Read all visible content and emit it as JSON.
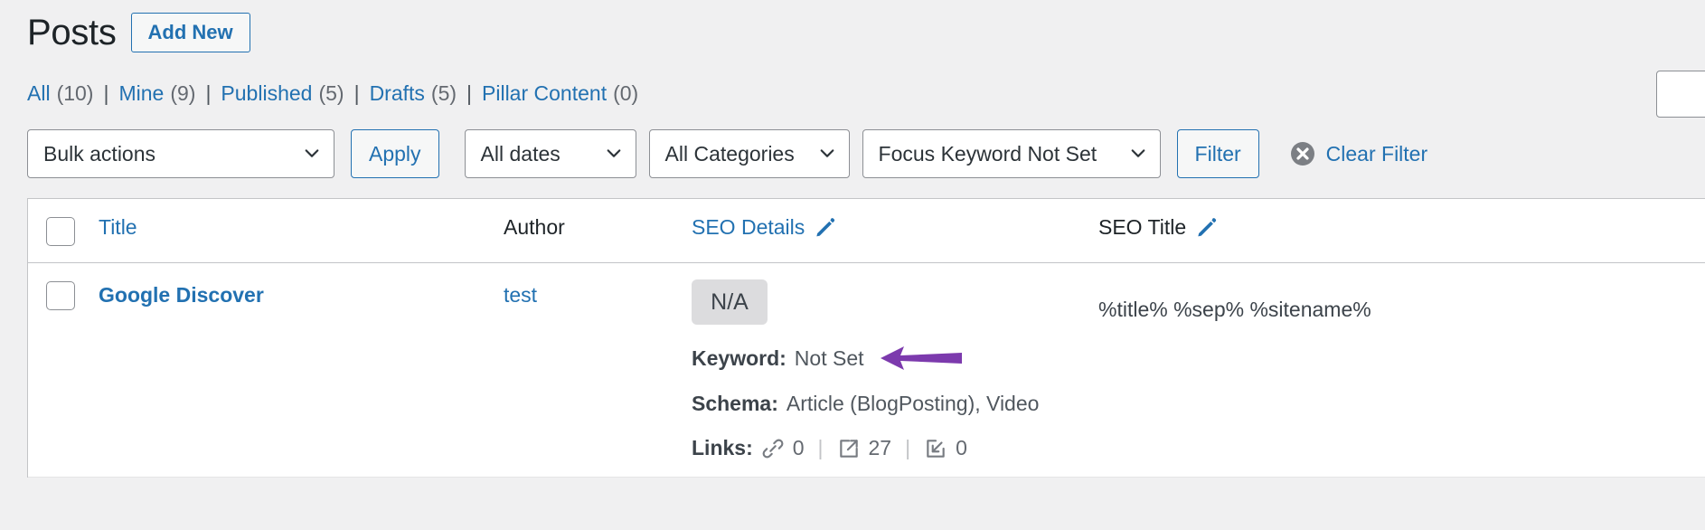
{
  "header": {
    "title": "Posts",
    "add_new_label": "Add New"
  },
  "status_links": [
    {
      "label": "All",
      "count": "(10)"
    },
    {
      "label": "Mine",
      "count": "(9)"
    },
    {
      "label": "Published",
      "count": "(5)"
    },
    {
      "label": "Drafts",
      "count": "(5)"
    },
    {
      "label": "Pillar Content",
      "count": "(0)"
    }
  ],
  "separator": "|",
  "toolbar": {
    "bulk_actions": "Bulk actions",
    "apply_label": "Apply",
    "all_dates": "All dates",
    "all_categories": "All Categories",
    "focus_keyword": "Focus Keyword Not Set",
    "filter_label": "Filter",
    "clear_filter_label": "Clear Filter",
    "clear_filter_icon": "x-circle-icon"
  },
  "table": {
    "columns": {
      "title": "Title",
      "author": "Author",
      "seo_details": "SEO Details",
      "seo_title": "SEO Title"
    },
    "edit_icon": "pencil-icon",
    "rows": [
      {
        "title": "Google Discover",
        "author": "test",
        "score_badge": "N/A",
        "keyword_label": "Keyword:",
        "keyword_value": "Not Set",
        "schema_label": "Schema:",
        "schema_value": "Article (BlogPosting), Video",
        "links_label": "Links:",
        "links": [
          {
            "icon": "link-chain-icon",
            "count": "0"
          },
          {
            "icon": "external-link-icon",
            "count": "27"
          },
          {
            "icon": "incoming-link-icon",
            "count": "0"
          }
        ],
        "links_separator": "|",
        "seo_title": "%title% %sep% %sitename%"
      }
    ]
  },
  "annotation": {
    "arrow_icon": "purple-left-arrow",
    "arrow_color": "#7c3aad"
  },
  "colors": {
    "link": "#2271b1",
    "page_bg": "#f0f0f1",
    "table_bg": "#ffffff",
    "badge_bg": "#dcdcde",
    "muted_text": "#646970"
  }
}
